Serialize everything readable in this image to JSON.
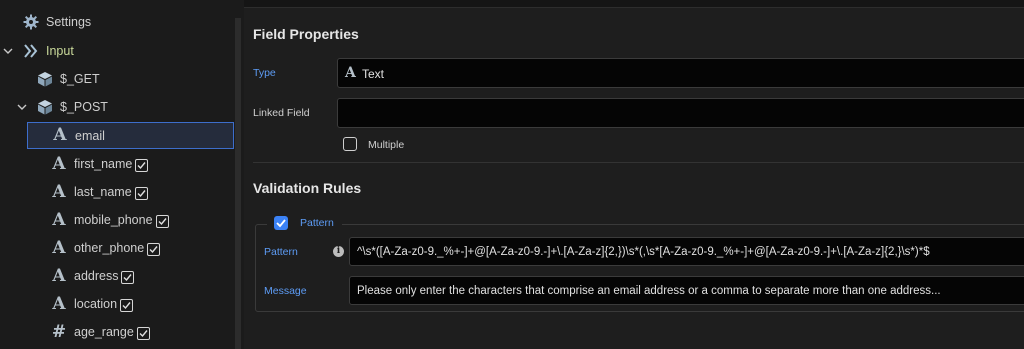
{
  "sidebar": {
    "settings": {
      "label": "Settings",
      "icon": "gear-icon"
    },
    "input": {
      "label": "Input",
      "icon": "double-chevron-icon",
      "color": "#c9d99a"
    },
    "get": {
      "label": "$_GET",
      "icon": "cube-icon"
    },
    "post": {
      "label": "$_POST",
      "icon": "cube-icon"
    },
    "fields": [
      {
        "label": "email",
        "icon": "text-icon",
        "checked": false,
        "selected": true
      },
      {
        "label": "first_name",
        "icon": "text-icon",
        "checked": true
      },
      {
        "label": "last_name",
        "icon": "text-icon",
        "checked": true
      },
      {
        "label": "mobile_phone",
        "icon": "text-icon",
        "checked": true
      },
      {
        "label": "other_phone",
        "icon": "text-icon",
        "checked": true
      },
      {
        "label": "address",
        "icon": "text-icon",
        "checked": true
      },
      {
        "label": "location",
        "icon": "text-icon",
        "checked": true
      },
      {
        "label": "age_range",
        "icon": "hash-icon",
        "checked": true
      }
    ]
  },
  "field_properties": {
    "title": "Field Properties",
    "type_label": "Type",
    "type_value": "Text",
    "linked_field_label": "Linked Field",
    "linked_field_value": "",
    "multiple_label": "Multiple",
    "multiple_checked": false
  },
  "validation": {
    "title": "Validation Rules",
    "pattern_legend": "Pattern",
    "pattern_enabled": true,
    "pattern_label": "Pattern",
    "pattern_value": "^\\s*([A-Za-z0-9._%+-]+@[A-Za-z0-9.-]+\\.[A-Za-z]{2,})\\s*(,\\s*[A-Za-z0-9._%+-]+@[A-Za-z0-9.-]+\\.[A-Za-z]{2,}\\s*)*$",
    "message_label": "Message",
    "message_value": "Please only enter the characters that comprise an email address or a comma to separate more than one address..."
  },
  "colors": {
    "accent": "#3b82f6",
    "label_blue": "#5d9cf5",
    "selected_border": "#3d6ecc"
  }
}
